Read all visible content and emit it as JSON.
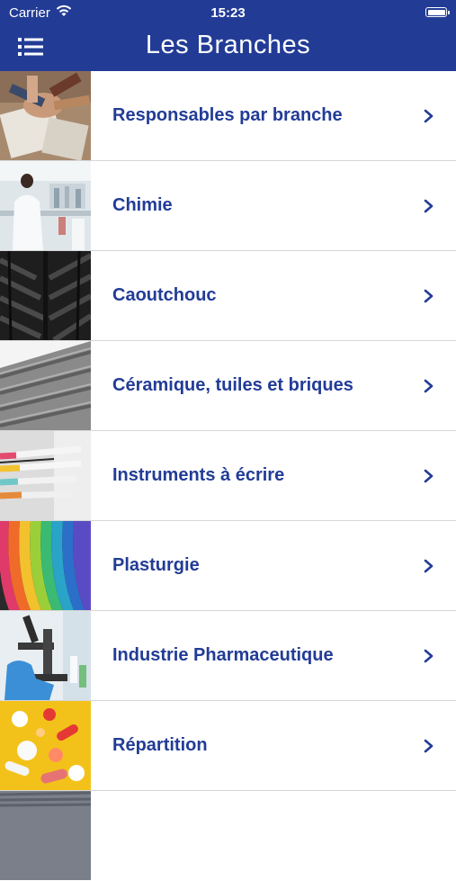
{
  "status_bar": {
    "carrier": "Carrier",
    "time": "15:23"
  },
  "header": {
    "title": "Les Branches",
    "menu_icon": "list-icon"
  },
  "colors": {
    "brand": "#223c96",
    "separator": "#d6d6d6"
  },
  "branches": [
    {
      "label": "Responsables par branche",
      "thumb": "hands-together"
    },
    {
      "label": "Chimie",
      "thumb": "laboratory"
    },
    {
      "label": "Caoutchouc",
      "thumb": "tire-tread"
    },
    {
      "label": "Céramique, tuiles et briques",
      "thumb": "roof-tiles"
    },
    {
      "label": "Instruments à écrire",
      "thumb": "pens"
    },
    {
      "label": "Plasturgie",
      "thumb": "colored-plastic"
    },
    {
      "label": "Industrie Pharmaceutique",
      "thumb": "microscope"
    },
    {
      "label": "Répartition",
      "thumb": "pills"
    }
  ]
}
